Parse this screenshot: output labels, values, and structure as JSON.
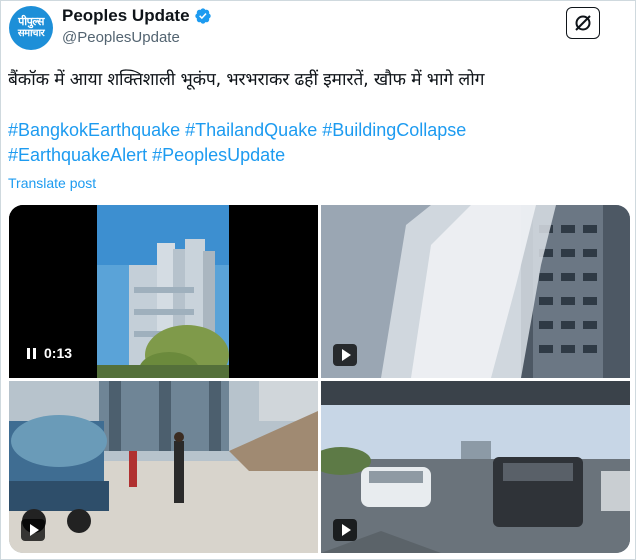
{
  "post": {
    "avatar": {
      "line1": "पीपुल्स",
      "line2": "समाचार"
    },
    "display_name": "Peoples Update",
    "handle": "@PeoplesUpdate",
    "text": "बैंकॉक में आया शक्तिशाली भूकंप, भरभराकर ढहीं इमारतें, खौफ में भागे लोग",
    "hashtags_line1": "#BangkokEarthquake #ThailandQuake #BuildingCollapse",
    "hashtags_line2": "#EarthquakeAlert #PeoplesUpdate",
    "translate_label": "Translate post",
    "grok_icon": "grok-icon",
    "verified_icon": "verified-badge-icon"
  },
  "media": {
    "video_timer": "0:13",
    "items": [
      {
        "kind": "video",
        "icon": "pause-icon"
      },
      {
        "kind": "video",
        "icon": "play-icon"
      },
      {
        "kind": "video",
        "icon": "play-icon"
      },
      {
        "kind": "video",
        "icon": "play-icon"
      }
    ]
  },
  "colors": {
    "accent": "#1d9bf0",
    "text": "#0f1419",
    "secondary": "#536471",
    "border": "#cfd9de"
  }
}
